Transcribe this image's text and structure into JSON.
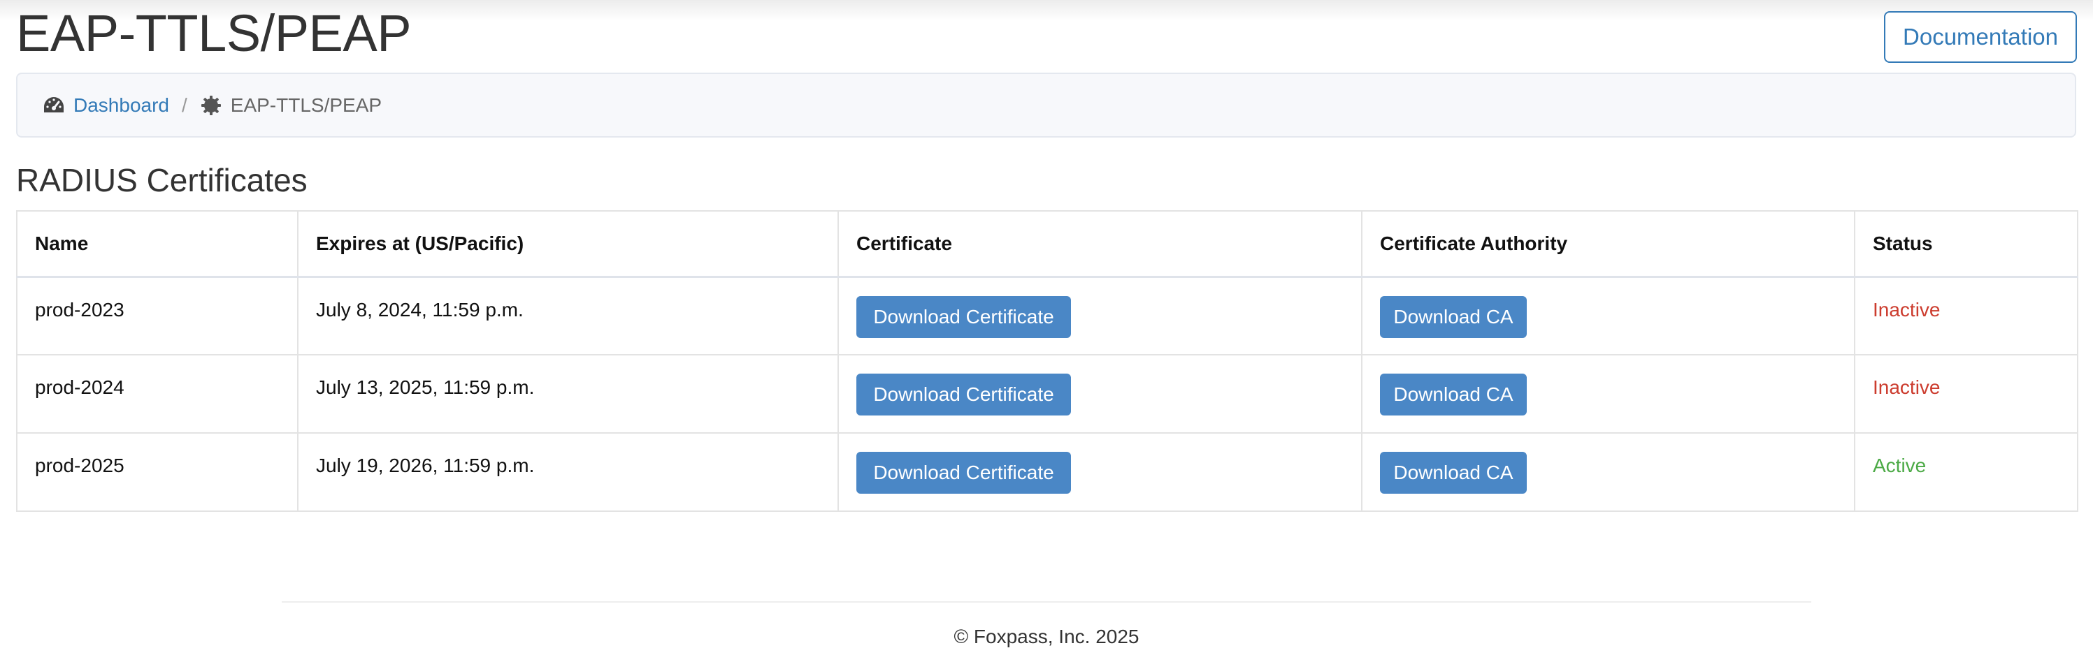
{
  "header": {
    "title": "EAP-TTLS/PEAP",
    "documentation_label": "Documentation"
  },
  "breadcrumb": {
    "items": [
      {
        "label": "Dashboard",
        "icon": "dashboard-icon"
      },
      {
        "label": "EAP-TTLS/PEAP",
        "icon": "gear-icon"
      }
    ],
    "separator": "/"
  },
  "section": {
    "title": "RADIUS Certificates"
  },
  "table": {
    "columns": [
      "Name",
      "Expires at (US/Pacific)",
      "Certificate",
      "Certificate Authority",
      "Status"
    ],
    "rows": [
      {
        "name": "prod-2023",
        "expires": "July 8, 2024, 11:59 p.m.",
        "cert_button": "Download Certificate",
        "ca_button": "Download CA",
        "status": "Inactive"
      },
      {
        "name": "prod-2024",
        "expires": "July 13, 2025, 11:59 p.m.",
        "cert_button": "Download Certificate",
        "ca_button": "Download CA",
        "status": "Inactive"
      },
      {
        "name": "prod-2025",
        "expires": "July 19, 2026, 11:59 p.m.",
        "cert_button": "Download Certificate",
        "ca_button": "Download CA",
        "status": "Active"
      }
    ]
  },
  "footer": {
    "copyright": "© Foxpass, Inc. 2025"
  },
  "colors": {
    "link": "#337ab7",
    "button": "#4a87c6",
    "inactive": "#cc3c2e",
    "active": "#4caa46"
  }
}
